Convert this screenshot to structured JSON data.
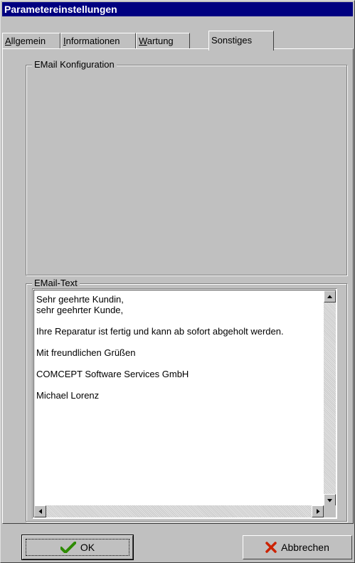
{
  "window": {
    "title": "Parametereinstellungen"
  },
  "tabs": [
    {
      "label": "Allgemein",
      "underline": "A",
      "rest": "llgemein"
    },
    {
      "label": "Informationen",
      "underline": "I",
      "rest": "nformationen"
    },
    {
      "label": "Wartung",
      "underline": "W",
      "rest": "artung"
    },
    {
      "label": "Sonstiges",
      "active": true
    }
  ],
  "email_config": {
    "group_label": "EMail Konfiguration"
  },
  "email_text": {
    "group_label": "EMail-Text",
    "value": "Sehr geehrte Kundin,\nsehr geehrter Kunde,\n\nIhre Reparatur ist fertig und kann ab sofort abgeholt werden.\n\nMit freundlichen Grüßen\n\nCOMCEPT Software Services GmbH\n\nMichael Lorenz"
  },
  "buttons": {
    "ok_label": "OK",
    "cancel_label": "Abbrechen"
  },
  "colors": {
    "titlebar": "#000080",
    "face": "#c0c0c0",
    "ok_check": "#2e8b00",
    "cancel_x": "#cc2200"
  },
  "icons": {
    "ok": "checkmark-icon",
    "cancel": "x-icon"
  }
}
